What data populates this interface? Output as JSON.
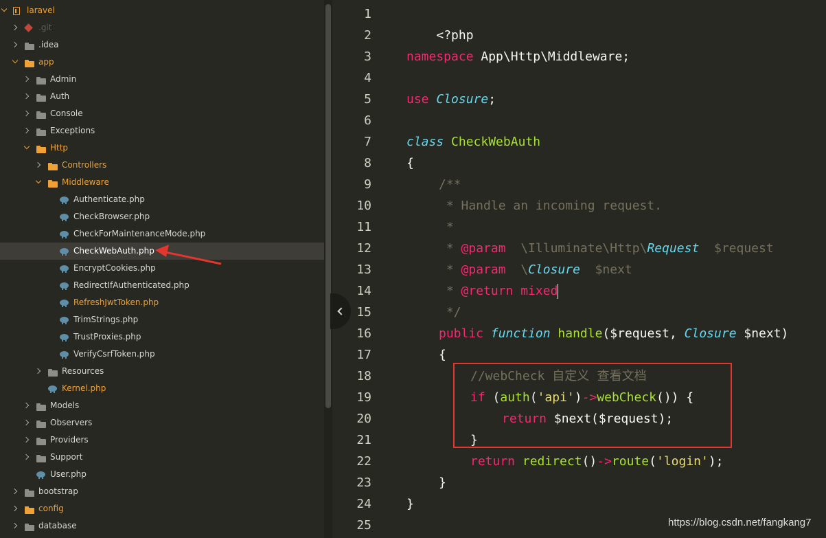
{
  "colors": {
    "background": "#272822",
    "keyword": "#f92672",
    "storage_italic": "#66d9ef",
    "function": "#a6e22e",
    "comment": "#75715e",
    "string": "#e6db74",
    "folder_open": "#f0a135",
    "highlight_box": "#e3362f"
  },
  "sidebar": {
    "items": [
      {
        "label": "laravel",
        "icon": "repo-icon"
      },
      {
        "label": ".git",
        "icon": "git-icon"
      },
      {
        "label": ".idea",
        "icon": "folder-icon"
      },
      {
        "label": "app",
        "icon": "folder-open-icon"
      },
      {
        "label": "Admin",
        "icon": "folder-icon"
      },
      {
        "label": "Auth",
        "icon": "folder-icon"
      },
      {
        "label": "Console",
        "icon": "folder-icon"
      },
      {
        "label": "Exceptions",
        "icon": "folder-icon"
      },
      {
        "label": "Http",
        "icon": "folder-open-icon"
      },
      {
        "label": "Controllers",
        "icon": "folder-icon"
      },
      {
        "label": "Middleware",
        "icon": "folder-open-icon"
      },
      {
        "label": "Authenticate.php",
        "icon": "php-file-icon"
      },
      {
        "label": "CheckBrowser.php",
        "icon": "php-file-icon"
      },
      {
        "label": "CheckForMaintenanceMode.php",
        "icon": "php-file-icon"
      },
      {
        "label": "CheckWebAuth.php",
        "icon": "php-file-icon"
      },
      {
        "label": "EncryptCookies.php",
        "icon": "php-file-icon"
      },
      {
        "label": "RedirectIfAuthenticated.php",
        "icon": "php-file-icon"
      },
      {
        "label": "RefreshJwtToken.php",
        "icon": "php-file-icon"
      },
      {
        "label": "TrimStrings.php",
        "icon": "php-file-icon"
      },
      {
        "label": "TrustProxies.php",
        "icon": "php-file-icon"
      },
      {
        "label": "VerifyCsrfToken.php",
        "icon": "php-file-icon"
      },
      {
        "label": "Resources",
        "icon": "folder-icon"
      },
      {
        "label": "Kernel.php",
        "icon": "php-file-icon"
      },
      {
        "label": "Models",
        "icon": "folder-icon"
      },
      {
        "label": "Observers",
        "icon": "folder-icon"
      },
      {
        "label": "Providers",
        "icon": "folder-icon"
      },
      {
        "label": "Support",
        "icon": "folder-icon"
      },
      {
        "label": "User.php",
        "icon": "php-file-icon"
      },
      {
        "label": "bootstrap",
        "icon": "folder-icon"
      },
      {
        "label": "config",
        "icon": "folder-open-icon"
      },
      {
        "label": "database",
        "icon": "folder-icon"
      }
    ]
  },
  "editor": {
    "line_numbers": [
      "1",
      "2",
      "3",
      "4",
      "5",
      "6",
      "7",
      "8",
      "9",
      "10",
      "11",
      "12",
      "13",
      "14",
      "15",
      "16",
      "17",
      "18",
      "19",
      "20",
      "21",
      "22",
      "23",
      "24",
      "25"
    ],
    "active_line": "14",
    "code": {
      "l1": {
        "t1": "<?php"
      },
      "l3": {
        "t1": "namespace",
        "t2": " App\\Http\\Middleware;"
      },
      "l5": {
        "t1": "use",
        "t2": " ",
        "t3": "Closure",
        "t4": ";"
      },
      "l7": {
        "t1": "class",
        "t2": " ",
        "t3": "CheckWebAuth"
      },
      "l8": {
        "t1": "{"
      },
      "l9": {
        "t1": "/**"
      },
      "l10": {
        "t1": " * Handle an incoming request."
      },
      "l11": {
        "t1": " *"
      },
      "l12": {
        "t1": " * ",
        "t2": "@param",
        "t3": "  \\Illuminate\\Http\\",
        "t4": "Request",
        "t5": "  $request"
      },
      "l13": {
        "t1": " * ",
        "t2": "@param",
        "t3": "  \\",
        "t4": "Closure",
        "t5": "  $next"
      },
      "l14": {
        "t1": " * ",
        "t2": "@return",
        "t3": " ",
        "t4": "mixed"
      },
      "l15": {
        "t1": " */"
      },
      "l16": {
        "t1": "public",
        "t2": " ",
        "t3": "function",
        "t4": " ",
        "t5": "handle",
        "t6": "($request, ",
        "t7": "Closure",
        "t8": " $next)"
      },
      "l17": {
        "t1": "{"
      },
      "l18": {
        "t1": "//webCheck ",
        "t2": "自定义  查看文档"
      },
      "l19": {
        "t1": "if",
        "t2": " (",
        "t3": "auth",
        "t4": "(",
        "t5": "'api'",
        "t6": ")",
        "t7": "->",
        "t8": "webCheck",
        "t9": "()) {"
      },
      "l20": {
        "t1": "return",
        "t2": " $next($request);"
      },
      "l21": {
        "t1": "}"
      },
      "l22": {
        "t1": "return",
        "t2": " ",
        "t3": "redirect",
        "t4": "()",
        "t5": "->",
        "t6": "route",
        "t7": "(",
        "t8": "'login'",
        "t9": ");"
      },
      "l23": {
        "t1": "}"
      },
      "l24": {
        "t1": "}"
      }
    }
  },
  "watermark": "https://blog.csdn.net/fangkang7"
}
